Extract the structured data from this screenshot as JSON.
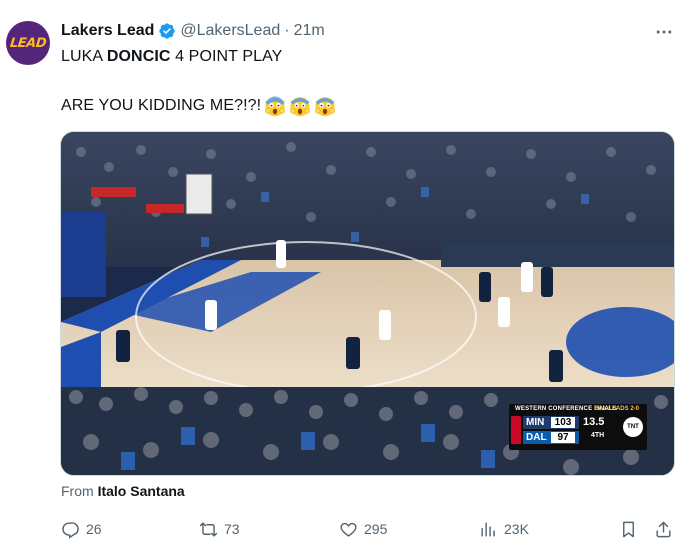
{
  "account": {
    "avatar_text": "LEAD",
    "display_name": "Lakers Lead",
    "handle": "@LakersLead",
    "separator": "·",
    "time": "21m",
    "verified_icon": "verified-badge-icon"
  },
  "tweet": {
    "line1_pre": "LUKA ",
    "line1_bold": "DONCIC",
    "line1_post": " 4 POINT PLAY",
    "line2_text": "ARE YOU KIDDING ME?!?!",
    "emojis": [
      "screaming-face-icon",
      "screaming-face-icon",
      "screaming-face-icon"
    ]
  },
  "media": {
    "scorebug": {
      "title": "WESTERN CONFERENCE FINALS",
      "series": "DAL LEADS 2-0",
      "team1": "MIN",
      "score1": "103",
      "team2": "DAL",
      "score2": "97",
      "clock": "13.5",
      "quarter": "4TH",
      "network": "TNT"
    }
  },
  "attribution": {
    "prefix": "From ",
    "source": "Italo Santana"
  },
  "actions": {
    "replies": "26",
    "retweets": "73",
    "likes": "295",
    "views": "23K"
  },
  "colors": {
    "verified": "#1d9bf0",
    "avatar_bg": "#55257a",
    "avatar_text": "#fdb927",
    "muted": "#536471"
  }
}
